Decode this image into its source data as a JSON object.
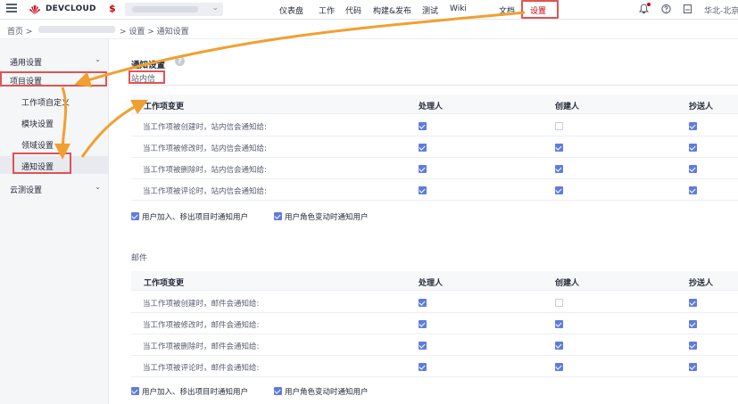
{
  "topbar": {
    "brand": "DEVCLOUD",
    "currency_symbol": "$",
    "nav": [
      "仪表盘",
      "工作",
      "代码",
      "构建&发布",
      "测试",
      "Wiki",
      "文档",
      "设置"
    ],
    "active_nav": "设置",
    "region": "华北-北京",
    "icons": [
      "menu-icon",
      "notification-icon",
      "help-icon",
      "save-icon"
    ],
    "accent_color": "#c7000b"
  },
  "breadcrumb": {
    "home": "首页 >",
    "rest": "> 设置 > 通知设置"
  },
  "sidebar": {
    "items": [
      {
        "label": "通用设置",
        "expanded": false
      },
      {
        "label": "项目设置",
        "expanded": true
      },
      {
        "label": "工作项自定义"
      },
      {
        "label": "模块设置"
      },
      {
        "label": "领域设置"
      },
      {
        "label": "通知设置",
        "active": true
      },
      {
        "label": "云测设置",
        "expanded": false
      }
    ]
  },
  "main": {
    "title": "通知设置",
    "help_glyph": "?",
    "sections": [
      {
        "name": "站内信",
        "headers": [
          "工作项变更",
          "处理人",
          "创建人",
          "抄送人"
        ],
        "rows": [
          {
            "label": "当工作项被创建时，站内信会通知给:",
            "checks": [
              true,
              false,
              true
            ]
          },
          {
            "label": "当工作项被修改时，站内信会通知给:",
            "checks": [
              true,
              true,
              true
            ]
          },
          {
            "label": "当工作项被删除时，站内信会通知给:",
            "checks": [
              true,
              true,
              true
            ]
          },
          {
            "label": "当工作项被评论时，站内信会通知给:",
            "checks": [
              true,
              true,
              true
            ]
          }
        ],
        "options": [
          {
            "label": "用户加入、移出项目时通知用户",
            "checked": true
          },
          {
            "label": "用户角色变动时通知用户",
            "checked": true
          }
        ]
      },
      {
        "name": "邮件",
        "headers": [
          "工作项变更",
          "处理人",
          "创建人",
          "抄送人"
        ],
        "rows": [
          {
            "label": "当工作项被创建时，邮件会通知给:",
            "checks": [
              true,
              false,
              true
            ]
          },
          {
            "label": "当工作项被修改时，邮件会通知给:",
            "checks": [
              true,
              true,
              true
            ]
          },
          {
            "label": "当工作项被删除时，邮件会通知给:",
            "checks": [
              true,
              true,
              true
            ]
          },
          {
            "label": "当工作项被评论时，邮件会通知给:",
            "checks": [
              true,
              true,
              true
            ]
          }
        ],
        "options": [
          {
            "label": "用户加入、移出项目时通知用户",
            "checked": true
          },
          {
            "label": "用户角色变动时通知用户",
            "checked": true
          }
        ]
      }
    ]
  },
  "annotation": {
    "highlight_color": "#e05353",
    "arrow_color": "#f0a030"
  }
}
